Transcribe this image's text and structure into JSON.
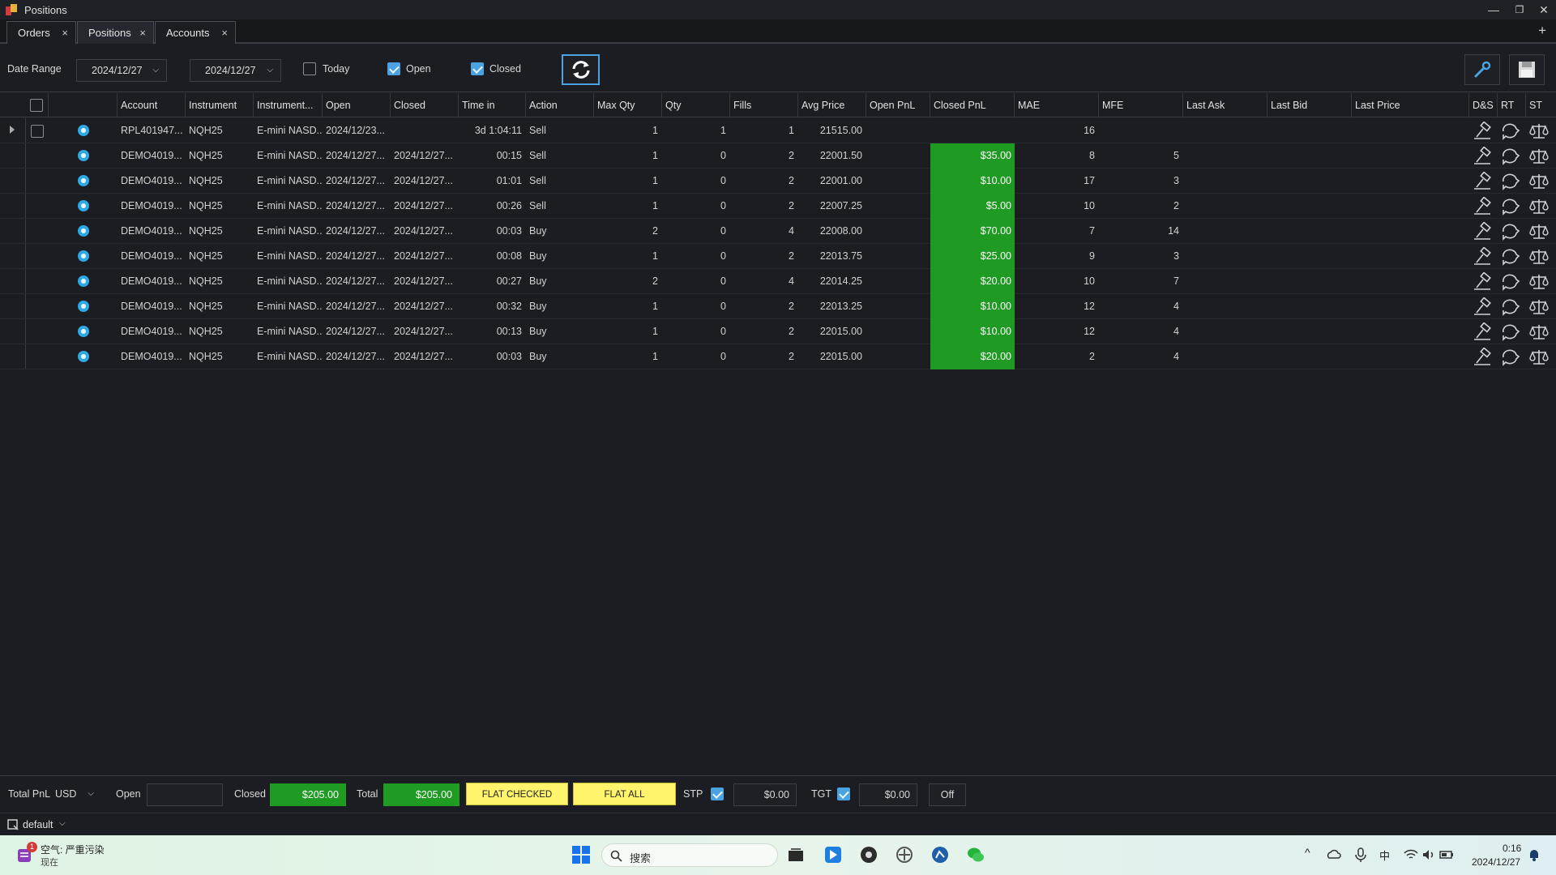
{
  "window": {
    "title": "Positions",
    "minimize": "—",
    "restore": "❐",
    "close": "✕"
  },
  "tabs": [
    {
      "label": "Orders",
      "close": "×"
    },
    {
      "label": "Positions",
      "close": "×"
    },
    {
      "label": "Accounts",
      "close": "×"
    }
  ],
  "tab_add": "+",
  "toolbar": {
    "date_range_label": "Date Range",
    "date_from": "2024/12/27",
    "date_to": "2024/12/27",
    "chevron": "⌵",
    "today_label": "Today",
    "today_checked": false,
    "open_label": "Open",
    "open_checked": true,
    "closed_label": "Closed",
    "closed_checked": true
  },
  "columns": [
    "Account",
    "Instrument",
    "Instrument...",
    "Open",
    "Closed",
    "Time in",
    "Action",
    "Max Qty",
    "Qty",
    "Fills",
    "Avg Price",
    "Open PnL",
    "Closed PnL",
    "MAE",
    "MFE",
    "Last Ask",
    "Last Bid",
    "Last Price",
    "D&S",
    "RT",
    "ST"
  ],
  "rows": [
    {
      "account": "RPL401947...",
      "instrument": "NQH25",
      "instrument_name": "E-mini NASD...",
      "open": "2024/12/23...",
      "closed": "",
      "time_in": "3d 1:04:11",
      "action": "Sell",
      "max_qty": "1",
      "qty": "1",
      "fills": "1",
      "avg_price": "21515.00",
      "open_pnl": "",
      "closed_pnl": "",
      "mae": "16",
      "mfe": "",
      "last_ask": "",
      "last_bid": "",
      "last_price": "",
      "expandable": true
    },
    {
      "account": "DEMO4019...",
      "instrument": "NQH25",
      "instrument_name": "E-mini NASD...",
      "open": "2024/12/27...",
      "closed": "2024/12/27...",
      "time_in": "00:15",
      "action": "Sell",
      "max_qty": "1",
      "qty": "0",
      "fills": "2",
      "avg_price": "22001.50",
      "open_pnl": "",
      "closed_pnl": "$35.00",
      "mae": "8",
      "mfe": "5",
      "last_ask": "",
      "last_bid": "",
      "last_price": "",
      "expandable": false
    },
    {
      "account": "DEMO4019...",
      "instrument": "NQH25",
      "instrument_name": "E-mini NASD...",
      "open": "2024/12/27...",
      "closed": "2024/12/27...",
      "time_in": "01:01",
      "action": "Sell",
      "max_qty": "1",
      "qty": "0",
      "fills": "2",
      "avg_price": "22001.00",
      "open_pnl": "",
      "closed_pnl": "$10.00",
      "mae": "17",
      "mfe": "3",
      "last_ask": "",
      "last_bid": "",
      "last_price": "",
      "expandable": false
    },
    {
      "account": "DEMO4019...",
      "instrument": "NQH25",
      "instrument_name": "E-mini NASD...",
      "open": "2024/12/27...",
      "closed": "2024/12/27...",
      "time_in": "00:26",
      "action": "Sell",
      "max_qty": "1",
      "qty": "0",
      "fills": "2",
      "avg_price": "22007.25",
      "open_pnl": "",
      "closed_pnl": "$5.00",
      "mae": "10",
      "mfe": "2",
      "last_ask": "",
      "last_bid": "",
      "last_price": "",
      "expandable": false
    },
    {
      "account": "DEMO4019...",
      "instrument": "NQH25",
      "instrument_name": "E-mini NASD...",
      "open": "2024/12/27...",
      "closed": "2024/12/27...",
      "time_in": "00:03",
      "action": "Buy",
      "max_qty": "2",
      "qty": "0",
      "fills": "4",
      "avg_price": "22008.00",
      "open_pnl": "",
      "closed_pnl": "$70.00",
      "mae": "7",
      "mfe": "14",
      "last_ask": "",
      "last_bid": "",
      "last_price": "",
      "expandable": false
    },
    {
      "account": "DEMO4019...",
      "instrument": "NQH25",
      "instrument_name": "E-mini NASD...",
      "open": "2024/12/27...",
      "closed": "2024/12/27...",
      "time_in": "00:08",
      "action": "Buy",
      "max_qty": "1",
      "qty": "0",
      "fills": "2",
      "avg_price": "22013.75",
      "open_pnl": "",
      "closed_pnl": "$25.00",
      "mae": "9",
      "mfe": "3",
      "last_ask": "",
      "last_bid": "",
      "last_price": "",
      "expandable": false
    },
    {
      "account": "DEMO4019...",
      "instrument": "NQH25",
      "instrument_name": "E-mini NASD...",
      "open": "2024/12/27...",
      "closed": "2024/12/27...",
      "time_in": "00:27",
      "action": "Buy",
      "max_qty": "2",
      "qty": "0",
      "fills": "4",
      "avg_price": "22014.25",
      "open_pnl": "",
      "closed_pnl": "$20.00",
      "mae": "10",
      "mfe": "7",
      "last_ask": "",
      "last_bid": "",
      "last_price": "",
      "expandable": false
    },
    {
      "account": "DEMO4019...",
      "instrument": "NQH25",
      "instrument_name": "E-mini NASD...",
      "open": "2024/12/27...",
      "closed": "2024/12/27...",
      "time_in": "00:32",
      "action": "Buy",
      "max_qty": "1",
      "qty": "0",
      "fills": "2",
      "avg_price": "22013.25",
      "open_pnl": "",
      "closed_pnl": "$10.00",
      "mae": "12",
      "mfe": "4",
      "last_ask": "",
      "last_bid": "",
      "last_price": "",
      "expandable": false
    },
    {
      "account": "DEMO4019...",
      "instrument": "NQH25",
      "instrument_name": "E-mini NASD...",
      "open": "2024/12/27...",
      "closed": "2024/12/27...",
      "time_in": "00:13",
      "action": "Buy",
      "max_qty": "1",
      "qty": "0",
      "fills": "2",
      "avg_price": "22015.00",
      "open_pnl": "",
      "closed_pnl": "$10.00",
      "mae": "12",
      "mfe": "4",
      "last_ask": "",
      "last_bid": "",
      "last_price": "",
      "expandable": false
    },
    {
      "account": "DEMO4019...",
      "instrument": "NQH25",
      "instrument_name": "E-mini NASD...",
      "open": "2024/12/27...",
      "closed": "2024/12/27...",
      "time_in": "00:03",
      "action": "Buy",
      "max_qty": "1",
      "qty": "0",
      "fills": "2",
      "avg_price": "22015.00",
      "open_pnl": "",
      "closed_pnl": "$20.00",
      "mae": "2",
      "mfe": "4",
      "last_ask": "",
      "last_bid": "",
      "last_price": "",
      "expandable": false
    }
  ],
  "bottom": {
    "total_pnl_label": "Total PnL",
    "currency": "USD",
    "open_label": "Open",
    "open_value": "",
    "closed_label": "Closed",
    "closed_value": "$205.00",
    "total_label": "Total",
    "total_value": "$205.00",
    "flat_checked": "FLAT CHECKED",
    "flat_all": "FLAT ALL",
    "stp_label": "STP",
    "stp_value": "$0.00",
    "tgt_label": "TGT",
    "tgt_value": "$0.00",
    "off_label": "Off"
  },
  "status": {
    "workspace": "default",
    "chevron": "⌵"
  },
  "taskbar": {
    "weather_badge": "1",
    "weather_text": "空气: 严重污染",
    "weather_sub": "现在",
    "search_placeholder": "搜索",
    "ime": "中",
    "time": "0:16",
    "date": "2024/12/27",
    "tray_up": "^"
  },
  "colors": {
    "pnl_green": "#1f9a22",
    "accent_blue": "#4aa3e0",
    "flat_yellow": "#fff46b"
  }
}
